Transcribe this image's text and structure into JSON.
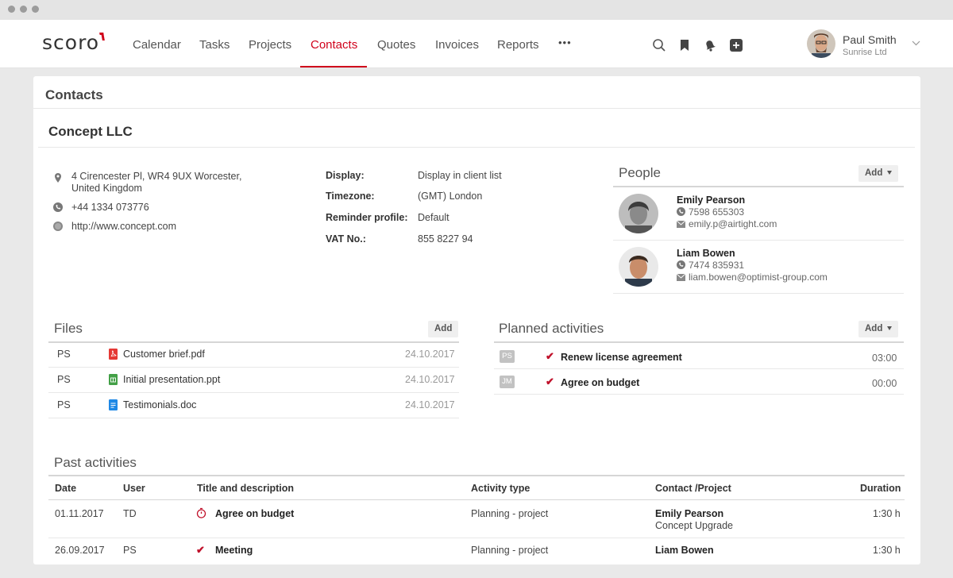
{
  "nav": {
    "logo": "scoro",
    "items": [
      "Calendar",
      "Tasks",
      "Projects",
      "Contacts",
      "Quotes",
      "Invoices",
      "Reports"
    ],
    "active_item": "Contacts",
    "more": "•••",
    "icons": [
      "search-icon",
      "bookmark-icon",
      "bell-icon",
      "plus-icon"
    ]
  },
  "user": {
    "name": "Paul Smith",
    "company": "Sunrise Ltd"
  },
  "page": {
    "title": "Contacts",
    "company": "Concept LLC"
  },
  "contact_info": {
    "address_line1": "4 Cirencester Pl, WR4 9UX Worcester,",
    "address_line2": "United Kingdom",
    "phone": "+44 1334 073776",
    "website": "http://www.concept.com"
  },
  "fields": [
    {
      "label": "Display:",
      "value": "Display in client list"
    },
    {
      "label": "Timezone:",
      "value": "(GMT) London"
    },
    {
      "label": "Reminder profile:",
      "value": "Default"
    },
    {
      "label": "VAT No.:",
      "value": "855 8227 94"
    }
  ],
  "people": {
    "title": "People",
    "add_label": "Add",
    "items": [
      {
        "name": "Emily Pearson",
        "phone": "7598 655303",
        "email": "emily.p@airtight.com"
      },
      {
        "name": "Liam Bowen",
        "phone": "7474 835931",
        "email": "liam.bowen@optimist-group.com"
      }
    ]
  },
  "files": {
    "title": "Files",
    "add_label": "Add",
    "items": [
      {
        "user": "PS",
        "name": "Customer brief.pdf",
        "date": "24.10.2017",
        "icon": "pdf-icon",
        "color": "#e53935"
      },
      {
        "user": "PS",
        "name": "Initial presentation.ppt",
        "date": "24.10.2017",
        "icon": "sheet-icon",
        "color": "#43a047"
      },
      {
        "user": "PS",
        "name": "Testimonials.doc",
        "date": "24.10.2017",
        "icon": "doc-icon",
        "color": "#1e88e5"
      }
    ]
  },
  "planned": {
    "title": "Planned activities",
    "add_label": "Add",
    "items": [
      {
        "user": "PS",
        "title": "Renew license agreement",
        "time": "03:00"
      },
      {
        "user": "JM",
        "title": "Agree on budget",
        "time": "00:00"
      }
    ]
  },
  "past": {
    "title": "Past activities",
    "columns": [
      "Date",
      "User",
      "Title and description",
      "Activity type",
      "Contact /Project",
      "Duration"
    ],
    "rows": [
      {
        "date": "01.11.2017",
        "user": "TD",
        "title": "Agree on budget",
        "type": "Planning - project",
        "contact": "Emily Pearson",
        "project": "Concept Upgrade",
        "duration": "1:30 h"
      },
      {
        "date": "26.09.2017",
        "user": "PS",
        "title": "Meeting",
        "type": "Planning - project",
        "contact": "Liam Bowen",
        "project": "",
        "duration": "1:30 h"
      }
    ]
  },
  "colors": {
    "accent": "#d0021b",
    "check": "#c0112b"
  }
}
